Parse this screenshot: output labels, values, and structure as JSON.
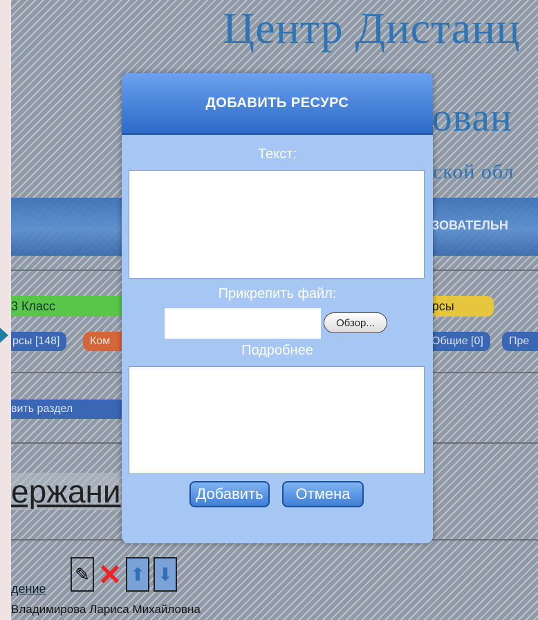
{
  "background": {
    "site_title_line1": "Центр Дистанц",
    "site_title_line2": "зован",
    "site_title_line3": "ской обл",
    "nav_text": "ЗОВАТЕЛЬН",
    "tag_class": "3 Класс",
    "tag_resources": "урсы",
    "tab_resources_count": "рсы [148]",
    "tab_comments": "Ком",
    "tab_general": "Общие [0]",
    "tab_more": "Пре",
    "add_section": "вить раздел",
    "content_heading": "ержани",
    "item_link": "дение",
    "author": "Владимирова Лариса Михайловна"
  },
  "modal": {
    "title": "ДОБАВИТЬ РЕСУРС",
    "text_label": "Текст:",
    "text_value": "",
    "attach_label": "Прикрепить файл:",
    "file_value": "",
    "browse_label": "Обзор...",
    "details_label": "Подробнее",
    "details_value": "",
    "add_button": "Добавить",
    "cancel_button": "Отмена"
  },
  "colors": {
    "modal_body": "#a6c6f4",
    "modal_header": "#2d6ac8",
    "button": "#3f7fd6"
  }
}
